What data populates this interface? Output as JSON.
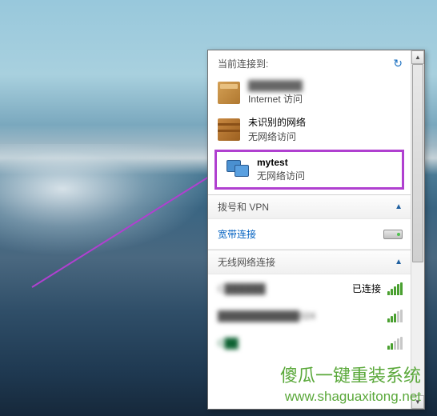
{
  "header": {
    "title": "当前连接到:"
  },
  "connections": [
    {
      "name": "████████",
      "status": "Internet 访问"
    },
    {
      "name": "未识别的网络",
      "status": "无网络访问"
    },
    {
      "name": "mytest",
      "status": "无网络访问"
    }
  ],
  "sections": {
    "dialup": {
      "title": "拨号和 VPN"
    },
    "broadband": {
      "label": "宽带连接"
    },
    "wireless": {
      "title": "无线网络连接"
    }
  },
  "wifi": [
    {
      "name": "C██████",
      "connected_label": "已连接"
    },
    {
      "name": "████████████024"
    },
    {
      "name": "C██"
    }
  ],
  "watermark": {
    "title": "傻瓜一键重装系统",
    "url": "www.shaguaxitong.net"
  }
}
